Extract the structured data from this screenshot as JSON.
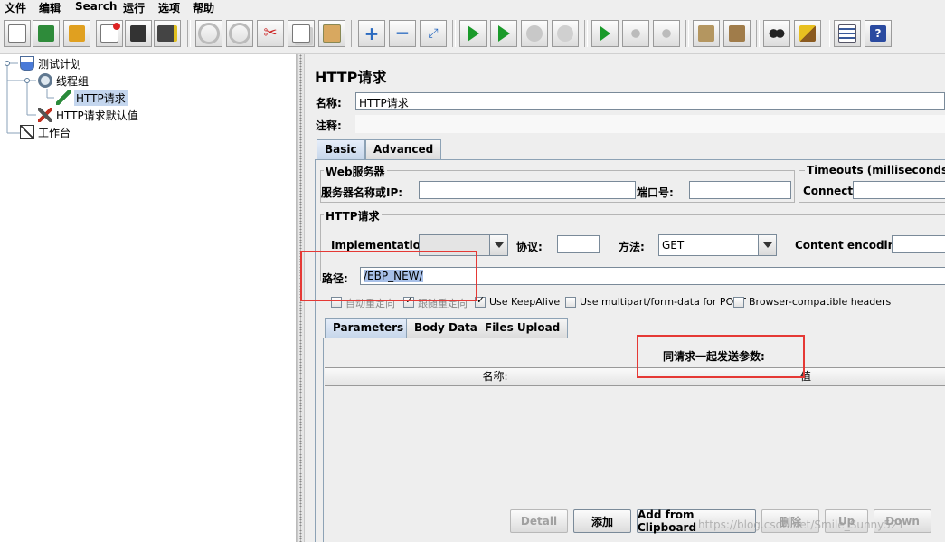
{
  "menu": [
    "文件",
    "编辑",
    "Search",
    "运行",
    "选项",
    "帮助"
  ],
  "toolbar": {
    "icons": [
      "new-icon",
      "templates-icon",
      "open-icon",
      "close-icon",
      "save-icon",
      "save-as-icon",
      "undo-icon",
      "redo-icon",
      "cut-icon",
      "copy-icon",
      "paste-icon",
      "expand-icon",
      "collapse-icon",
      "toggle-icon",
      "start-icon",
      "start-no-timers-icon",
      "stop-icon",
      "shutdown-icon",
      "remote-start-icon",
      "remote-stop-icon",
      "remote-shutdown-icon",
      "clear-icon",
      "clear-all-icon",
      "search-icon",
      "reset-search-icon",
      "function-helper-icon",
      "help-icon"
    ]
  },
  "tree": {
    "items": [
      {
        "label": "测试计划"
      },
      {
        "label": "线程组"
      },
      {
        "label": "HTTP请求"
      },
      {
        "label": "HTTP请求默认值"
      },
      {
        "label": "工作台"
      }
    ]
  },
  "panel": {
    "title": "HTTP请求",
    "name_label": "名称:",
    "name_value": "HTTP请求",
    "comment_label": "注释:",
    "tabs": [
      "Basic",
      "Advanced"
    ],
    "web_server": {
      "legend": "Web服务器",
      "server_label": "服务器名称或IP:",
      "port_label": "端口号:"
    },
    "timeouts": {
      "legend": "Timeouts (milliseconds)",
      "connect_label": "Connect:"
    },
    "http_request": {
      "legend": "HTTP请求",
      "impl_label": "Implementation:",
      "protocol_label": "协议:",
      "method_label": "方法:",
      "method_value": "GET",
      "encoding_label": "Content encoding:",
      "path_label": "路径:",
      "path_value": "/EBP_NEW/"
    },
    "checkboxes": [
      {
        "label": "自动重定向",
        "checked": false
      },
      {
        "label": "跟随重定向",
        "checked": true
      },
      {
        "label": "Use KeepAlive",
        "checked": true
      },
      {
        "label": "Use multipart/form-data for POST",
        "checked": false
      },
      {
        "label": "Browser-compatible headers",
        "checked": false
      }
    ],
    "sub_tabs": [
      "Parameters",
      "Body Data",
      "Files Upload"
    ],
    "params_title": "同请求一起发送参数:",
    "columns": [
      "名称:",
      "值"
    ],
    "buttons": [
      {
        "label": "Detail",
        "enabled": false
      },
      {
        "label": "添加",
        "enabled": true
      },
      {
        "label": "Add from Clipboard",
        "enabled": true
      },
      {
        "label": "删除",
        "enabled": false
      },
      {
        "label": "Up",
        "enabled": false
      },
      {
        "label": "Down",
        "enabled": false
      }
    ],
    "watermark": "https://blog.csdn.net/Smile_Sunny521"
  }
}
